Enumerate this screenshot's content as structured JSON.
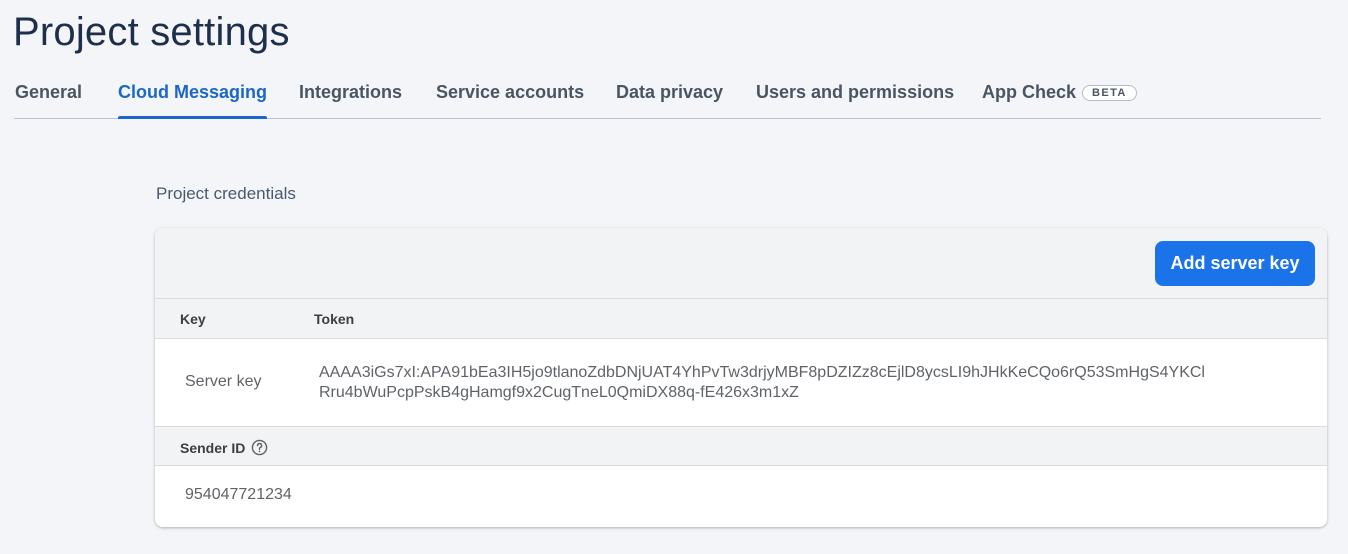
{
  "page": {
    "title": "Project settings"
  },
  "tabs": [
    {
      "label": "General"
    },
    {
      "label": "Cloud Messaging",
      "active": true
    },
    {
      "label": "Integrations"
    },
    {
      "label": "Service accounts"
    },
    {
      "label": "Data privacy"
    },
    {
      "label": "Users and permissions"
    },
    {
      "label": "App Check",
      "badge": "BETA"
    }
  ],
  "credentials": {
    "section_label": "Project credentials",
    "add_button_label": "Add server key",
    "columns": {
      "key": "Key",
      "token": "Token"
    },
    "server_key": {
      "name": "Server key",
      "token_line1": "AAAA3iGs7xI:APA91bEa3IH5jo9tlanoZdbDNjUAT4YhPvTw3drjyMBF8pDZIZz8cEjlD8ycsLI9hJHkKeCQo6rQ53SmHgS4YKCl",
      "token_line2": "Rru4bWuPcpPskB4gHamgf9x2CugTneL0QmiDX88q-fE426x3m1xZ"
    },
    "sender": {
      "label": "Sender ID",
      "help_icon": "help-circle-icon",
      "value": "954047721234"
    }
  },
  "colors": {
    "accent": "#1b66c9",
    "button": "#1a73e8",
    "title": "#1d2f4a"
  }
}
